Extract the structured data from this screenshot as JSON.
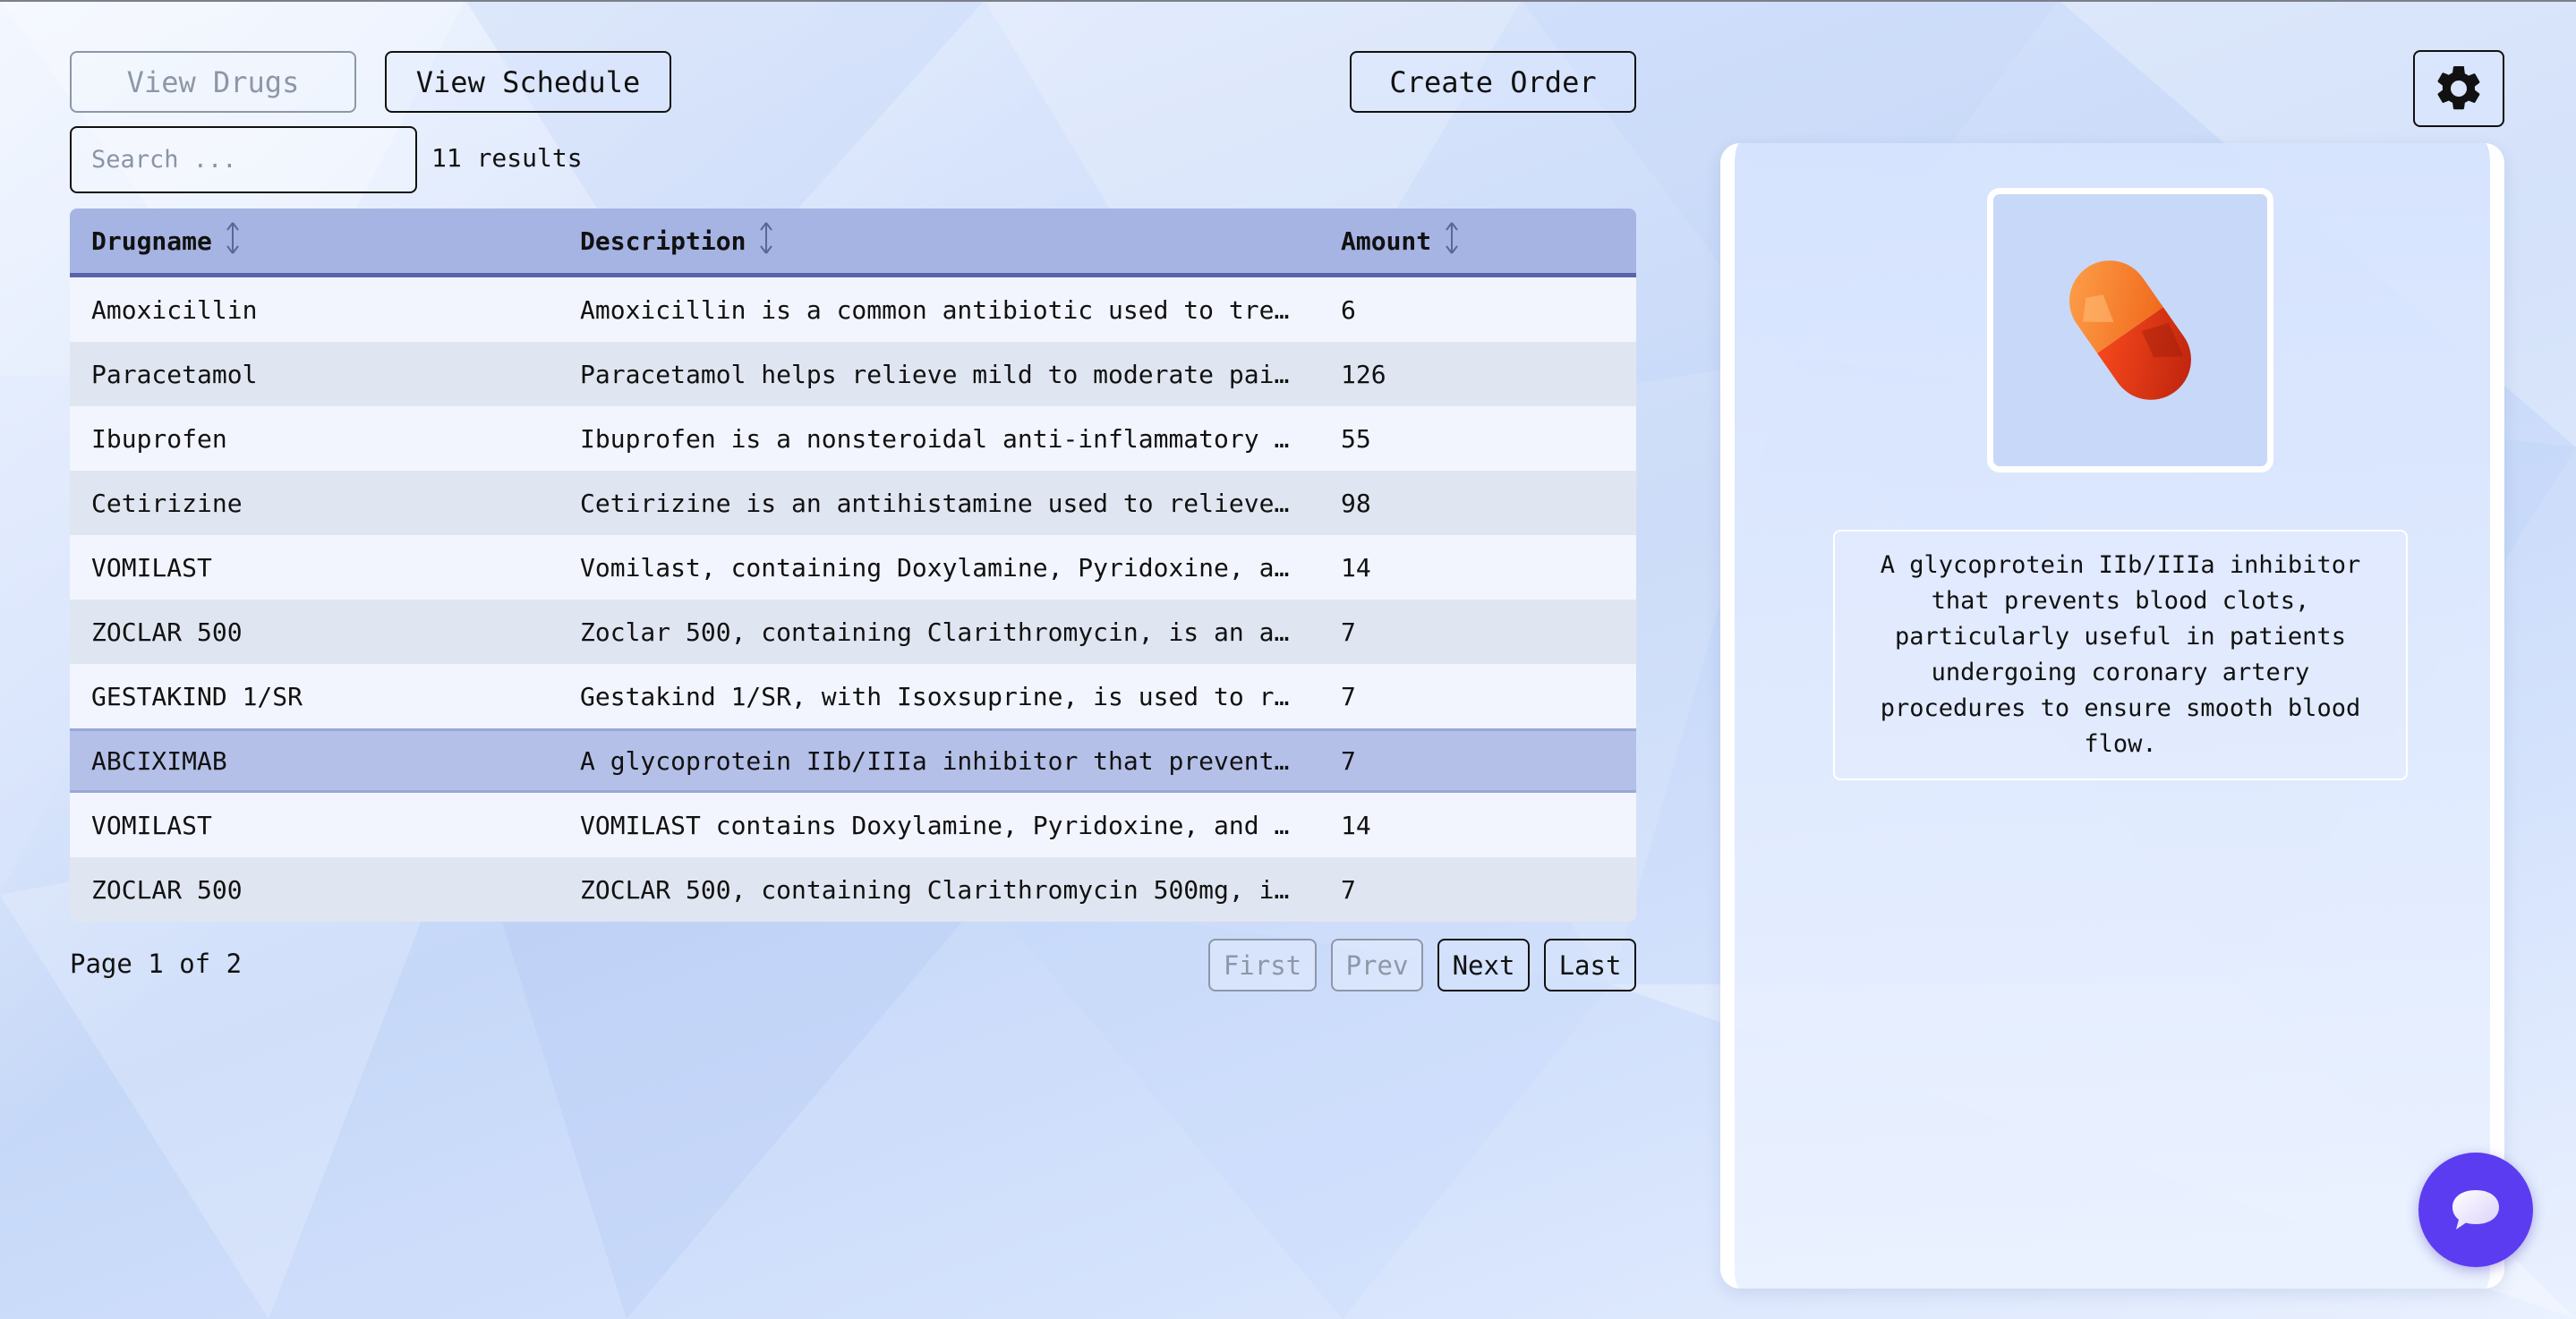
{
  "toolbar": {
    "view_drugs_label": "View Drugs",
    "view_schedule_label": "View Schedule",
    "create_order_label": "Create Order"
  },
  "search": {
    "placeholder": "Search ...",
    "value": ""
  },
  "results_count": "11 results",
  "table": {
    "columns": [
      {
        "label": "Drugname"
      },
      {
        "label": "Description"
      },
      {
        "label": "Amount"
      }
    ],
    "rows": [
      {
        "drugname": "Amoxicillin",
        "description": "Amoxicillin is a common antibiotic used to tre…",
        "amount": "6"
      },
      {
        "drugname": "Paracetamol",
        "description": "Paracetamol helps relieve mild to moderate pai…",
        "amount": "126"
      },
      {
        "drugname": "Ibuprofen",
        "description": "Ibuprofen is a nonsteroidal anti-inflammatory …",
        "amount": "55"
      },
      {
        "drugname": "Cetirizine",
        "description": "Cetirizine is an antihistamine used to relieve…",
        "amount": "98"
      },
      {
        "drugname": "VOMILAST",
        "description": "Vomilast, containing Doxylamine, Pyridoxine, a…",
        "amount": "14"
      },
      {
        "drugname": "ZOCLAR 500",
        "description": "Zoclar 500, containing Clarithromycin, is an a…",
        "amount": "7"
      },
      {
        "drugname": "GESTAKIND 1/SR",
        "description": "Gestakind 1/SR, with Isoxsuprine, is used to r…",
        "amount": "7"
      },
      {
        "drugname": "ABCIXIMAB",
        "description": "A glycoprotein IIb/IIIa inhibitor that prevent…",
        "amount": "7"
      },
      {
        "drugname": "VOMILAST",
        "description": "VOMILAST contains Doxylamine, Pyridoxine, and …",
        "amount": "14"
      },
      {
        "drugname": "ZOCLAR 500",
        "description": "ZOCLAR 500, containing Clarithromycin 500mg, i…",
        "amount": "7"
      }
    ]
  },
  "pagination": {
    "info": "Page 1 of 2",
    "first_label": "First",
    "prev_label": "Prev",
    "next_label": "Next",
    "last_label": "Last"
  },
  "detail": {
    "image_icon": "capsule-pill-icon",
    "description": "A glycoprotein IIb/IIIa inhibitor that prevents blood clots, particularly useful in patients undergoing coronary artery procedures to ensure smooth blood flow."
  },
  "icons": {
    "settings": "gear-icon",
    "chat": "chat-bubble-icon",
    "sort": "sort-arrows-icon"
  },
  "colors": {
    "header_bg": "#a6b4e3",
    "header_border": "#5a63aa",
    "row_odd": "#f2f5fd",
    "row_even": "#e0e6f1",
    "row_selected": "#b4c0e8",
    "chat_button": "#5c3cf0",
    "capsule": "#f0501e"
  }
}
